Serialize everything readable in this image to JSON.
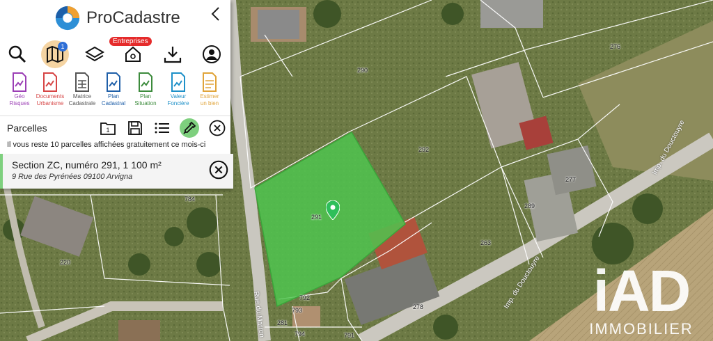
{
  "app": {
    "name": "ProCadastre"
  },
  "toolbar": {
    "layers_badge": "1",
    "entreprises_badge": "Entreprises"
  },
  "docs": [
    {
      "line1": "Géo",
      "line2": "Risques",
      "color": "#9b3fb5"
    },
    {
      "line1": "Documents",
      "line2": "Urbanisme",
      "color": "#d64545"
    },
    {
      "line1": "Matrice",
      "line2": "Cadastrale",
      "color": "#555555"
    },
    {
      "line1": "Plan",
      "line2": "Cadastral",
      "color": "#1f5fa8"
    },
    {
      "line1": "Plan",
      "line2": "Situation",
      "color": "#3c8b3c"
    },
    {
      "line1": "Valeur",
      "line2": "Foncière",
      "color": "#1e90c8"
    },
    {
      "line1": "Estimer",
      "line2": "un bien",
      "color": "#e0a43a"
    }
  ],
  "parcelles": {
    "title": "Parcelles",
    "folder_count": "1",
    "notice": "Il vous reste 10 parcelles affichées gratuitement ce mois-ci",
    "selected": {
      "title": "Section ZC, numéro 291, 1 100 m²",
      "address": "9 Rue des Pyrénées 09100 Arvigna"
    }
  },
  "map": {
    "parcel_labels": [
      "290",
      "276",
      "292",
      "291",
      "277",
      "289",
      "784",
      "263",
      "220",
      "792",
      "793",
      "278",
      "281",
      "794",
      "791"
    ],
    "streets": [
      "Imp. du Douctouyre",
      "Imp. du Douctouyre",
      "Rue du Marron"
    ],
    "watermark": {
      "logo": "iAD",
      "sub": "IMMOBILIER"
    },
    "selected_parcel_color": "#4fc44f"
  }
}
